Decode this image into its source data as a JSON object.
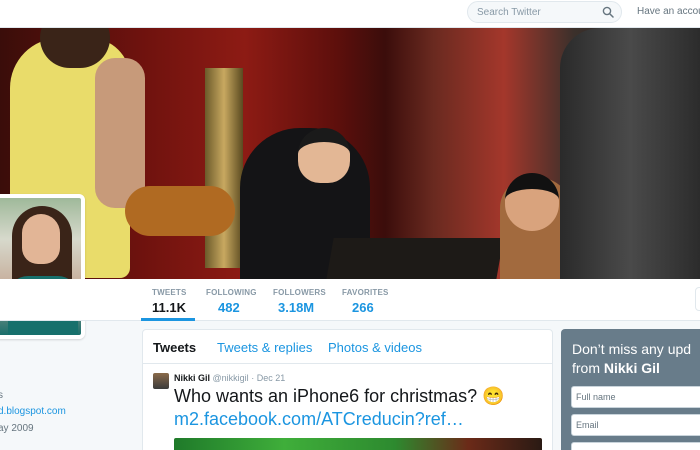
{
  "topbar": {
    "search_placeholder": "Search Twitter",
    "account_link": "Have an account"
  },
  "profile": {
    "left_lines": [
      "s",
      "d.blogspot.com",
      "ay 2009"
    ]
  },
  "stats": [
    {
      "label": "TWEETS",
      "value": "11.1K"
    },
    {
      "label": "FOLLOWING",
      "value": "482"
    },
    {
      "label": "FOLLOWERS",
      "value": "3.18M"
    },
    {
      "label": "FAVORITES",
      "value": "266"
    }
  ],
  "tabs": [
    "Tweets",
    "Tweets & replies",
    "Photos & videos"
  ],
  "tweet": {
    "name": "Nikki Gil",
    "handle": "@nikkigil",
    "separator": "·",
    "date": "Dec 21",
    "text": "Who wants an iPhone6 for christmas? 😁",
    "link": "m2.facebook.com/ATCreducin?ref…"
  },
  "signup": {
    "title_line1": "Don’t miss any upd",
    "title_prefix": "from ",
    "title_name": "Nikki Gil",
    "fields": [
      "Full name",
      "Email"
    ]
  },
  "colors": {
    "accent": "#1b95e0",
    "signup_bg": "#687c8a"
  }
}
